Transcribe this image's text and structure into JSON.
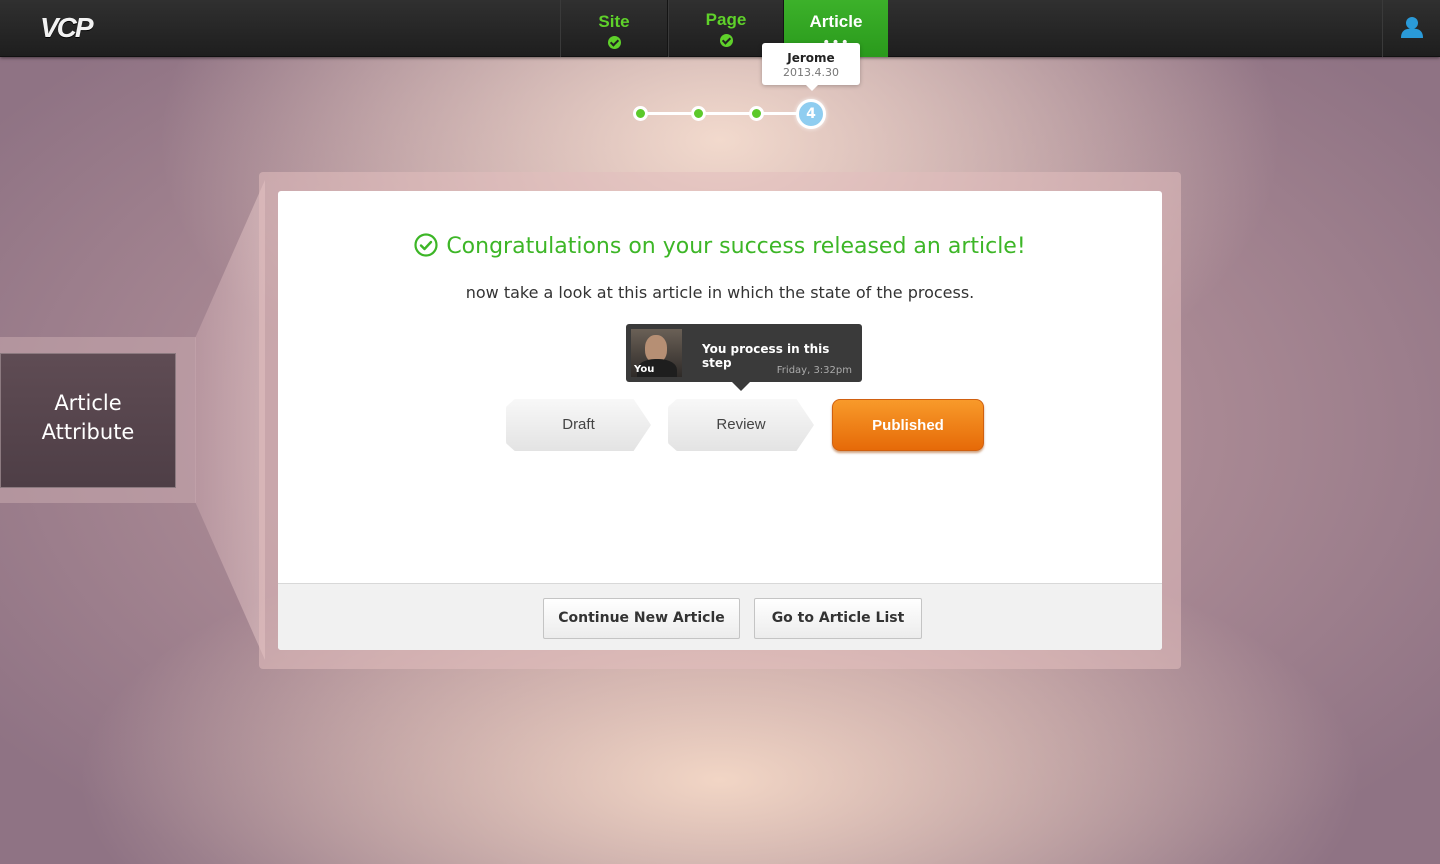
{
  "app": {
    "logo": "VCP"
  },
  "nav": {
    "tabs": [
      {
        "label": "Site",
        "state": "done"
      },
      {
        "label": "Page",
        "state": "done"
      },
      {
        "label": "Article",
        "state": "active",
        "dots": "•••"
      }
    ]
  },
  "progress": {
    "tooltip": {
      "name": "Jerome",
      "date": "2013.4.30"
    },
    "current_step": "4",
    "completed_steps": 3
  },
  "side": {
    "label_line1": "Article",
    "label_line2": "Attribute"
  },
  "card": {
    "headline": "Congratulations on your success released an article!",
    "subline": "now take a look at this article in which the state of the process.",
    "process_tip": {
      "avatar_label": "You",
      "text": "You process in this step",
      "time": "Friday, 3:32pm"
    },
    "states": [
      {
        "label": "Draft"
      },
      {
        "label": "Review"
      },
      {
        "label": "Published"
      }
    ],
    "footer": {
      "continue_label": "Continue New Article",
      "list_label": "Go to Article List"
    }
  },
  "colors": {
    "accent_green": "#3db627",
    "published_orange": "#f07f16",
    "step_current": "#8fcdf0",
    "user_icon": "#2a9ad8"
  },
  "icons": {
    "user": "user-icon",
    "check": "check-circle-icon"
  }
}
